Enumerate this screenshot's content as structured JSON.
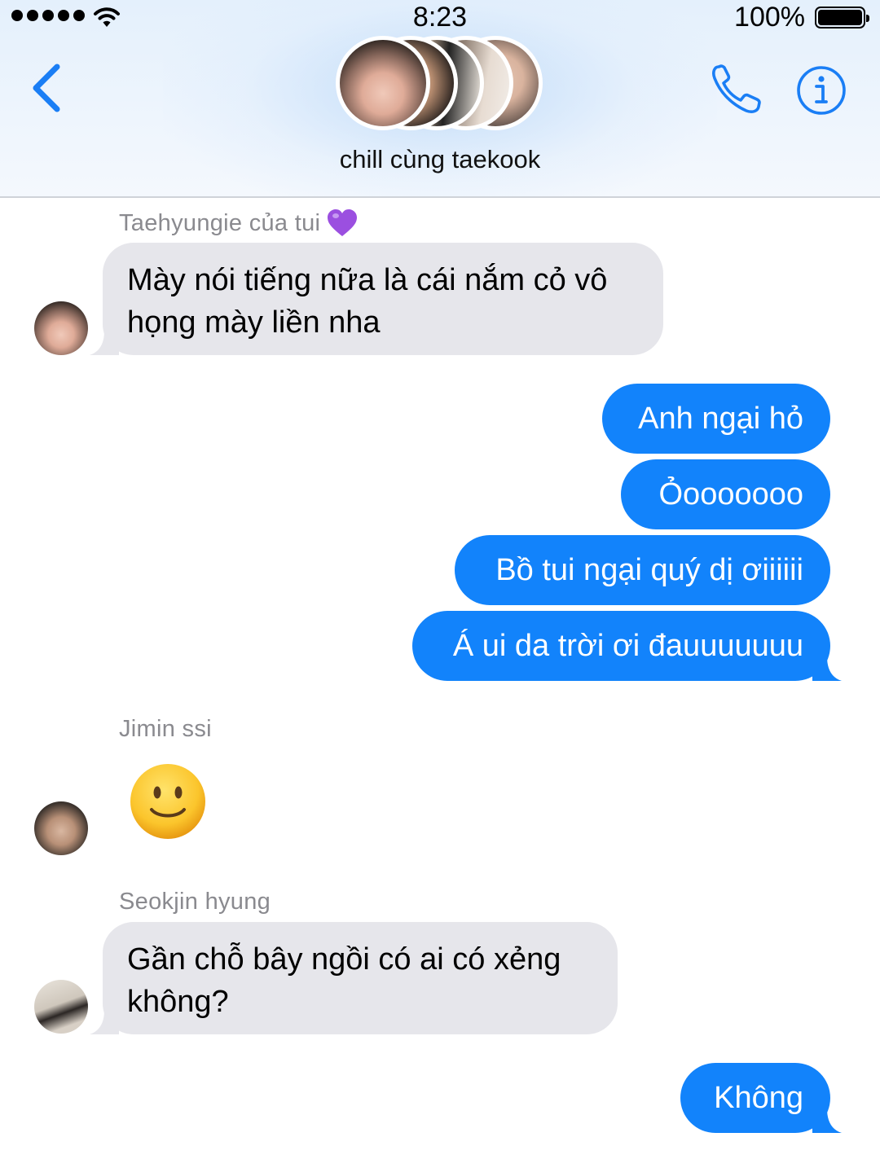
{
  "status_bar": {
    "time": "8:23",
    "battery": "100%",
    "signal_icon": "signal-dots-icon",
    "wifi_icon": "wifi-icon"
  },
  "header": {
    "back_icon": "chevron-left-icon",
    "group_name": "chill cùng taekook",
    "call_icon": "phone-icon",
    "info_icon": "info-icon",
    "accent_color": "#1a7ef5"
  },
  "messages": [
    {
      "sender": "Taehyungie của tui",
      "sender_emoji": "purple-heart-icon",
      "direction": "incoming",
      "lines": [
        "Mày nói tiếng nữa là cái nắm cỏ vô",
        "họng mày liền nha"
      ]
    },
    {
      "direction": "outgoing",
      "text": "Anh ngại hỏ"
    },
    {
      "direction": "outgoing",
      "text": "Ỏooooooo"
    },
    {
      "direction": "outgoing",
      "text": "Bồ tui ngại quý dị ơiiiiii"
    },
    {
      "direction": "outgoing",
      "text": "Á ui da trời ơi đauuuuuuu"
    },
    {
      "sender": "Jimin ssi",
      "direction": "incoming",
      "emoji": "slightly-smiling-face-icon"
    },
    {
      "sender": "Seokjin hyung",
      "direction": "incoming",
      "lines": [
        "Gần chỗ bây ngồi có ai có xẻng",
        "không?"
      ]
    },
    {
      "direction": "outgoing",
      "text": "Không"
    }
  ],
  "colors": {
    "outgoing_bubble": "#1283fb",
    "incoming_bubble": "#e6e6eb",
    "sender_label": "#8a8a8f"
  }
}
